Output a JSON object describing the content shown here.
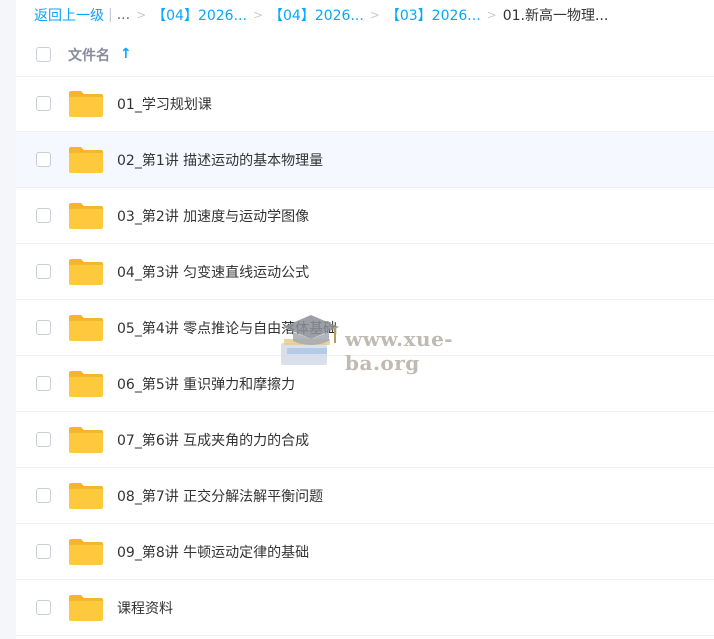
{
  "breadcrumb": {
    "back": "返回上一级",
    "ellipsis": "...",
    "crumbs": [
      "【04】2026...",
      "【04】2026...",
      "【03】2026..."
    ],
    "current": "01.新高一物理..."
  },
  "header": {
    "column_label": "文件名",
    "sort_icon": "arrow-up-icon"
  },
  "files": [
    {
      "name": "01_学习规划课",
      "icon": "folder-icon"
    },
    {
      "name": "02_第1讲 描述运动的基本物理量",
      "icon": "folder-icon"
    },
    {
      "name": "03_第2讲 加速度与运动学图像",
      "icon": "folder-icon"
    },
    {
      "name": "04_第3讲 匀变速直线运动公式",
      "icon": "folder-icon"
    },
    {
      "name": "05_第4讲 零点推论与自由落体基础",
      "icon": "folder-icon"
    },
    {
      "name": "06_第5讲 重识弹力和摩擦力",
      "icon": "folder-icon"
    },
    {
      "name": "07_第6讲 互成夹角的力的合成",
      "icon": "folder-icon"
    },
    {
      "name": "08_第7讲 正交分解法解平衡问题",
      "icon": "folder-icon"
    },
    {
      "name": "09_第8讲 牛顿运动定律的基础",
      "icon": "folder-icon"
    },
    {
      "name": "课程资料",
      "icon": "folder-icon"
    }
  ],
  "watermark": {
    "text": "www.xue-ba.org"
  },
  "colors": {
    "accent": "#06a7ff",
    "folder": "#ffc93d",
    "folder_dark": "#f7b52c"
  }
}
